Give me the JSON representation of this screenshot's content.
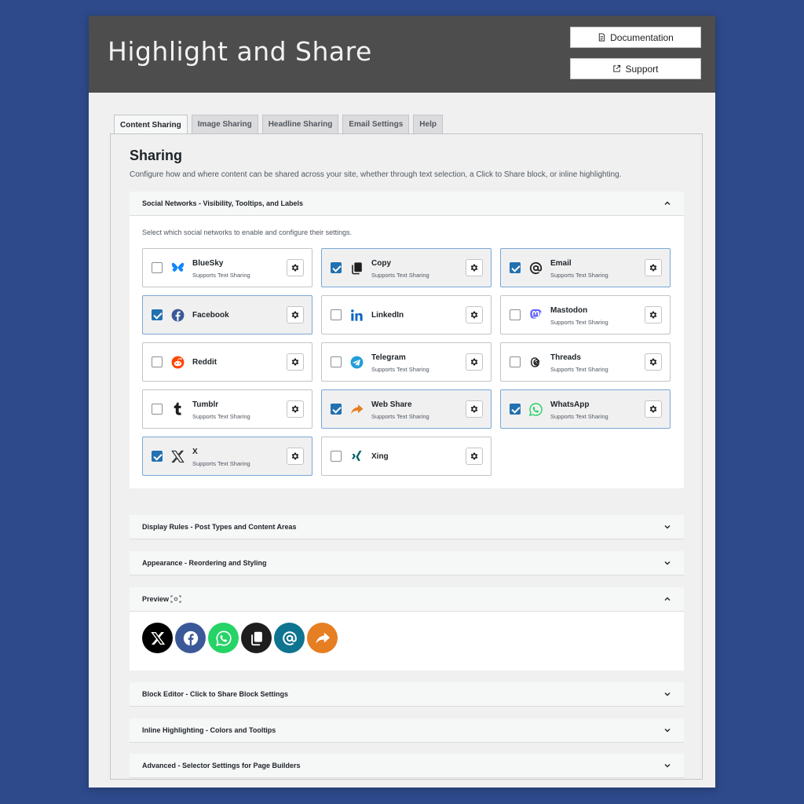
{
  "header": {
    "title": "Highlight and Share",
    "documentation_label": "Documentation",
    "support_label": "Support"
  },
  "tabs": [
    {
      "label": "Content Sharing",
      "active": true
    },
    {
      "label": "Image Sharing"
    },
    {
      "label": "Headline Sharing"
    },
    {
      "label": "Email Settings"
    },
    {
      "label": "Help"
    }
  ],
  "page": {
    "heading": "Sharing",
    "description": "Configure how and where content can be shared across your site, whether through text selection, a Click to Share block, or inline highlighting."
  },
  "sections": {
    "social": {
      "title": "Social Networks - Visibility, Tooltips, and Labels",
      "expanded": true,
      "note": "Select which social networks to enable and configure their settings."
    },
    "display": {
      "title": "Display Rules - Post Types and Content Areas"
    },
    "appearance": {
      "title": "Appearance - Reordering and Styling"
    },
    "preview": {
      "title": "Preview",
      "expanded": true
    },
    "block": {
      "title": "Block Editor - Click to Share Block Settings"
    },
    "inline": {
      "title": "Inline Highlighting - Colors and Tooltips"
    },
    "advanced": {
      "title": "Advanced - Selector Settings for Page Builders"
    }
  },
  "supports_text": "Supports Text Sharing",
  "networks": [
    {
      "name": "BlueSky",
      "checked": false,
      "supports_text": true,
      "icon": "bluesky-icon"
    },
    {
      "name": "Copy",
      "checked": true,
      "supports_text": true,
      "icon": "copy-icon"
    },
    {
      "name": "Email",
      "checked": true,
      "supports_text": true,
      "icon": "email-at-icon"
    },
    {
      "name": "Facebook",
      "checked": true,
      "supports_text": false,
      "icon": "facebook-icon"
    },
    {
      "name": "LinkedIn",
      "checked": false,
      "supports_text": false,
      "icon": "linkedin-icon"
    },
    {
      "name": "Mastodon",
      "checked": false,
      "supports_text": true,
      "icon": "mastodon-icon"
    },
    {
      "name": "Reddit",
      "checked": false,
      "supports_text": false,
      "icon": "reddit-icon"
    },
    {
      "name": "Telegram",
      "checked": false,
      "supports_text": true,
      "icon": "telegram-icon"
    },
    {
      "name": "Threads",
      "checked": false,
      "supports_text": true,
      "icon": "threads-icon"
    },
    {
      "name": "Tumblr",
      "checked": false,
      "supports_text": true,
      "icon": "tumblr-icon"
    },
    {
      "name": "Web Share",
      "checked": true,
      "supports_text": true,
      "icon": "web-share-icon"
    },
    {
      "name": "WhatsApp",
      "checked": true,
      "supports_text": true,
      "icon": "whatsapp-icon"
    },
    {
      "name": "X",
      "checked": true,
      "supports_text": true,
      "icon": "x-icon"
    },
    {
      "name": "Xing",
      "checked": false,
      "supports_text": false,
      "icon": "xing-icon"
    }
  ],
  "preview_buttons": [
    {
      "icon": "x-icon",
      "color": "#000000"
    },
    {
      "icon": "facebook-icon",
      "color": "#3b5998"
    },
    {
      "icon": "whatsapp-icon",
      "color": "#25d366"
    },
    {
      "icon": "copy-icon",
      "color": "#1e1e1e"
    },
    {
      "icon": "email-at-icon",
      "color": "#0e7490"
    },
    {
      "icon": "web-share-icon",
      "color": "#e67e22"
    }
  ],
  "colors": {
    "background": "#2e4a8b",
    "header": "#4d4d4d",
    "checkbox_checked": "#2271b1"
  }
}
